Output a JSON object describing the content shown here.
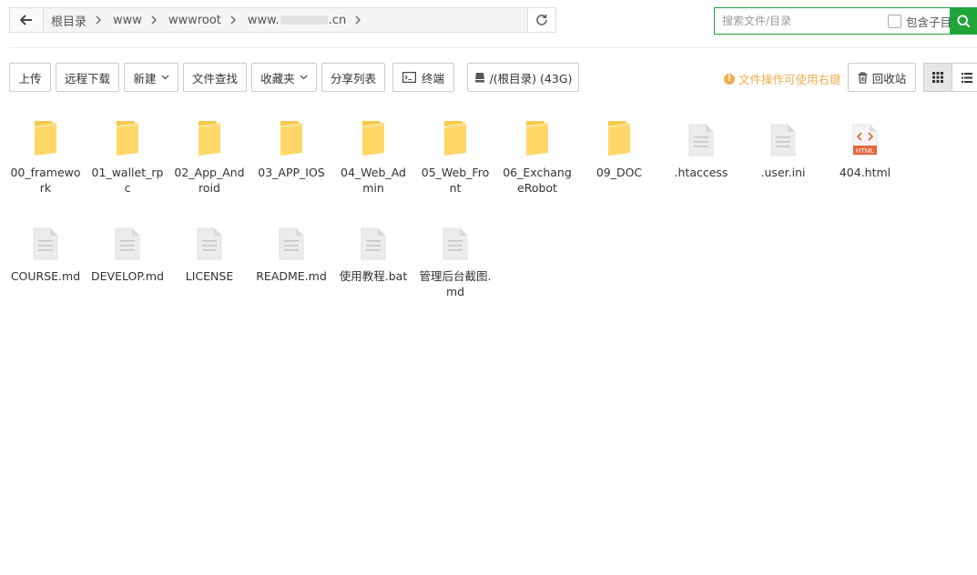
{
  "path": {
    "crumbs": [
      "根目录",
      "www",
      "wwwroot"
    ],
    "last_prefix": "www.",
    "last_suffix": ".cn"
  },
  "search": {
    "placeholder": "搜索文件/目录",
    "subdir_label": "包含子目录"
  },
  "toolbar": {
    "upload": "上传",
    "remote_download": "远程下载",
    "new": "新建",
    "find": "文件查找",
    "favorites": "收藏夹",
    "share_list": "分享列表",
    "terminal": "终端",
    "disk": "/(根目录) (43G)",
    "warning": "文件操作可使用右键",
    "recycle": "回收站"
  },
  "colors": {
    "accent": "#20a53a",
    "warning": "#f0ad4e",
    "folder": "#ffd766",
    "html_badge": "#e8663d"
  },
  "files": [
    {
      "name": "00_framework",
      "type": "folder"
    },
    {
      "name": "01_wallet_rpc",
      "type": "folder"
    },
    {
      "name": "02_App_Android",
      "type": "folder"
    },
    {
      "name": "03_APP_IOS",
      "type": "folder"
    },
    {
      "name": "04_Web_Admin",
      "type": "folder"
    },
    {
      "name": "05_Web_Front",
      "type": "folder"
    },
    {
      "name": "06_ExchangeRobot",
      "type": "folder"
    },
    {
      "name": "09_DOC",
      "type": "folder"
    },
    {
      "name": ".htaccess",
      "type": "file"
    },
    {
      "name": ".user.ini",
      "type": "file"
    },
    {
      "name": "404.html",
      "type": "html"
    },
    {
      "name": "COURSE.md",
      "type": "file"
    },
    {
      "name": "DEVELOP.md",
      "type": "file"
    },
    {
      "name": "LICENSE",
      "type": "file"
    },
    {
      "name": "README.md",
      "type": "file"
    },
    {
      "name": "使用教程.bat",
      "type": "file"
    },
    {
      "name": "管理后台截图.md",
      "type": "file"
    }
  ]
}
